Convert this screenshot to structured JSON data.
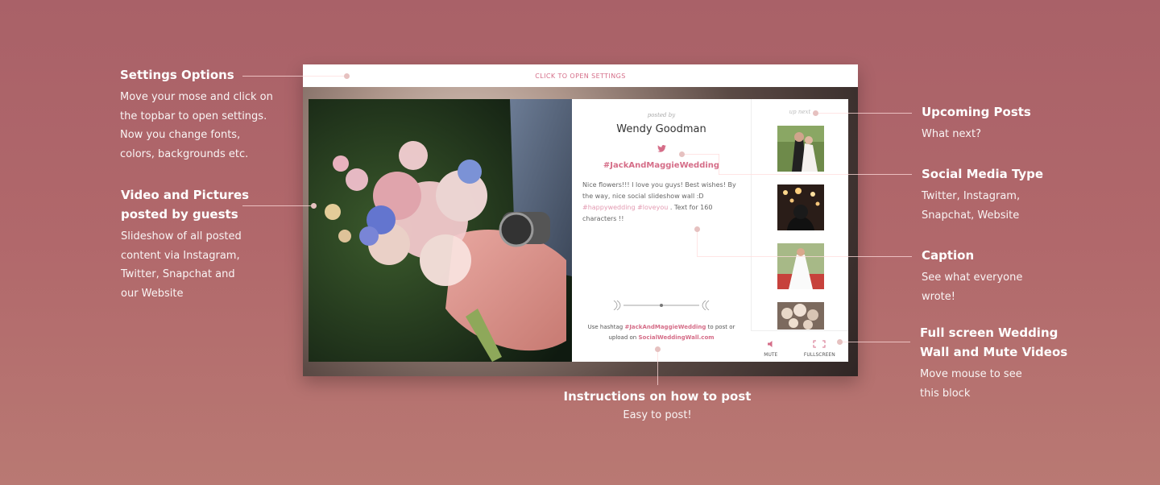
{
  "annotations": {
    "settings": {
      "title": "Settings Options",
      "desc": [
        "Move your mose and click on",
        "the topbar to open settings.",
        "Now you change fonts,",
        "colors, backgrounds etc."
      ]
    },
    "video": {
      "title": [
        "Video and Pictures",
        "posted by guests"
      ],
      "desc": [
        "Slideshow of all posted",
        "content via Instagram,",
        "Twitter, Snapchat and",
        "our Website"
      ]
    },
    "upcoming": {
      "title": "Upcoming Posts",
      "desc": [
        "What next?"
      ]
    },
    "social": {
      "title": "Social Media Type",
      "desc": [
        "Twitter, Instagram,",
        "Snapchat, Website"
      ]
    },
    "caption": {
      "title": "Caption",
      "desc": [
        "See what everyone",
        "wrote!"
      ]
    },
    "fullscreen": {
      "title": [
        "Full screen Wedding",
        "Wall and Mute Videos"
      ],
      "desc": [
        "Move mouse to see",
        "this block"
      ]
    },
    "instructions": {
      "title": "Instructions on how to post",
      "desc": "Easy to post!"
    }
  },
  "app": {
    "topbar": "CLICK TO OPEN SETTINGS",
    "post": {
      "posted_by": "posted by",
      "author": "Wendy Goodman",
      "social_icon": "twitter-icon",
      "hashtag": "#JackAndMaggieWedding",
      "caption_text": "Nice flowers!!! I love you guys! Best wishes! By the way, nice social slideshow wall :D",
      "caption_tags": "#happywedding #loveyou",
      "caption_tail": ". Text for 160 characters !!",
      "instr_prefix": "Use hashtag",
      "instr_tag": "#JackAndMaggieWedding",
      "instr_mid": "to post or upload on",
      "instr_site": "SocialWeddingWall.com"
    },
    "upnext": {
      "label": "up next",
      "thumbs": [
        "couple-thumb",
        "crowd-thumb",
        "bride-thumb",
        "flowers-thumb"
      ]
    },
    "controls": {
      "mute": "MUTE",
      "fullscreen": "FULLSCREEN"
    }
  },
  "colors": {
    "accent": "#d56d88",
    "background": "#b1686b",
    "line": "#f3d6d4"
  }
}
